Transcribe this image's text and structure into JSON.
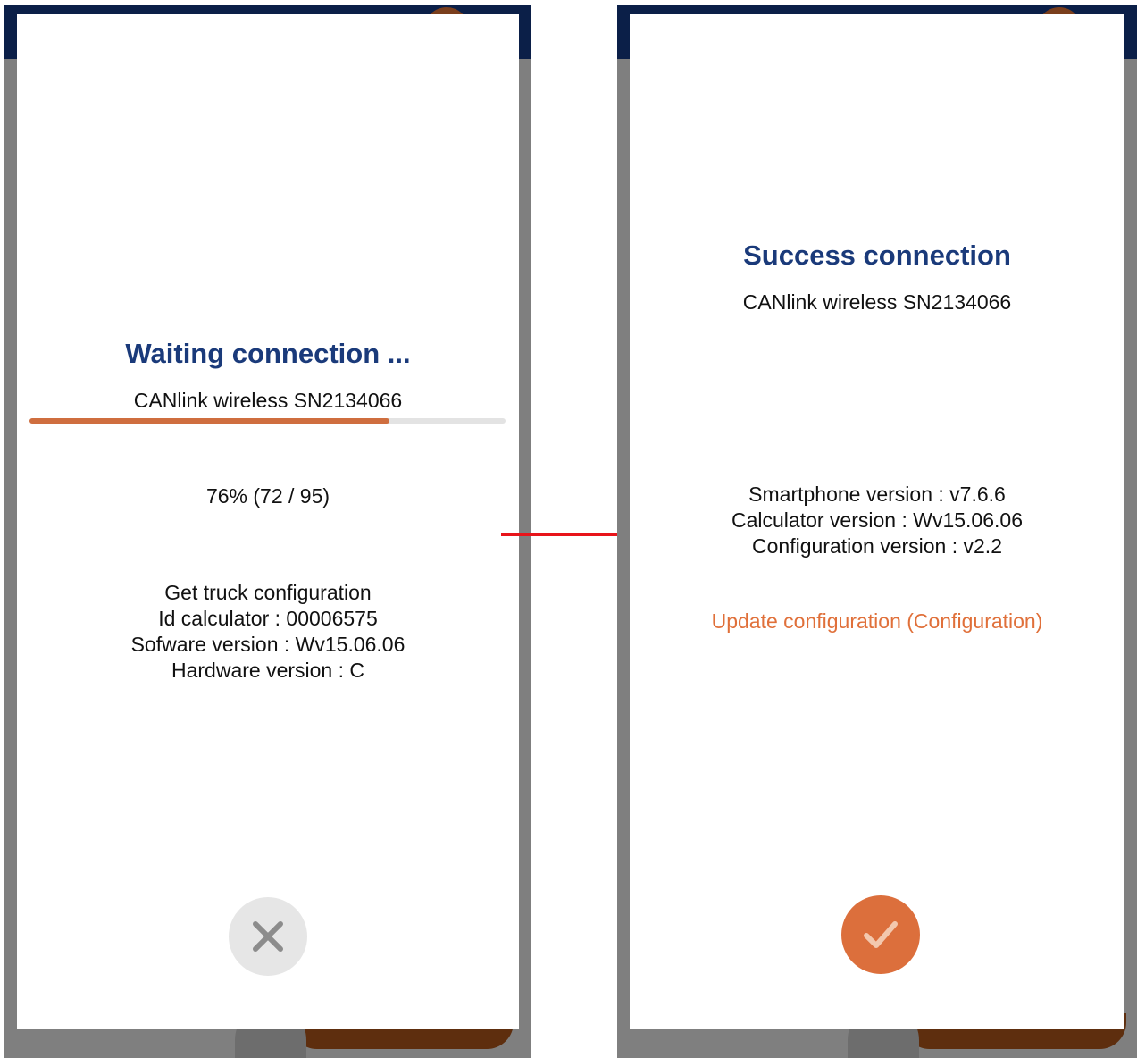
{
  "left_screen": {
    "title": "Waiting connection ...",
    "device": "CANlink wireless SN2134066",
    "progress_fraction": 0.757,
    "progress_text": "76% (72 / 95)",
    "details": [
      "Get truck configuration",
      "Id calculator : 00006575",
      "Sofware version : Wv15.06.06",
      "Hardware version : C"
    ],
    "cancel_icon": "close-icon"
  },
  "right_screen": {
    "title": "Success connection",
    "device": "CANlink wireless SN2134066",
    "versions": [
      "Smartphone version : v7.6.6",
      "Calculator version : Wv15.06.06",
      "Configuration version : v2.2"
    ],
    "update_link": "Update configuration (Configuration)",
    "confirm_icon": "check-icon"
  },
  "colors": {
    "title": "#1a3a7a",
    "accent": "#dc6f3c",
    "progress": "#cf6e3f",
    "arrow": "#e8141a",
    "header": "#0b1f48"
  }
}
